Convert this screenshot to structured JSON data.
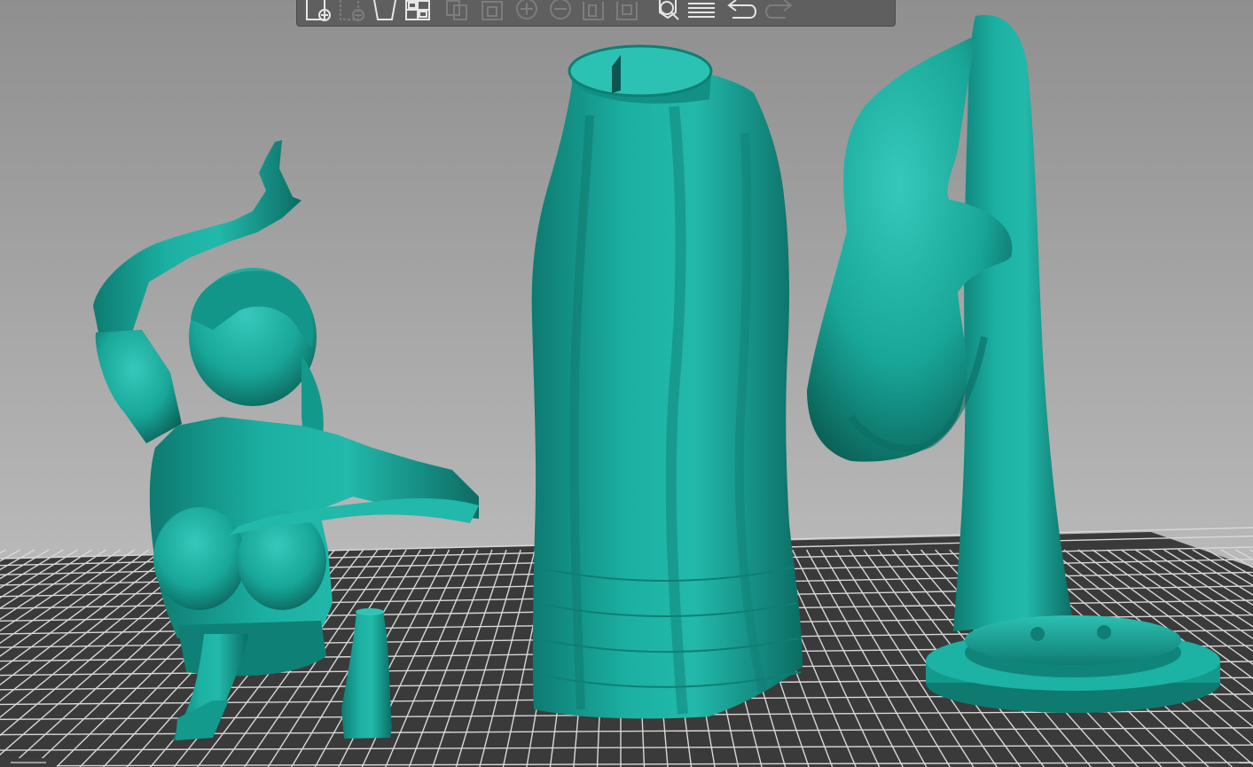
{
  "colors": {
    "model_teal": "#17a89b",
    "model_shadow": "#0d7168",
    "model_highlight": "#3fcfc1",
    "bed_grid": "#dcdcdc",
    "bed_base": "#3a3a3a",
    "toolbar_bg": "#5f5f5f",
    "icon_active": "#e6e6e6",
    "icon_disabled": "#7d7d7d"
  },
  "toolbar": {
    "buttons": [
      {
        "icon": "add-file-icon",
        "enabled": true
      },
      {
        "icon": "remove-selection-icon",
        "enabled": false
      },
      {
        "icon": "delete-all-icon",
        "enabled": true
      },
      {
        "icon": "arrange-icon",
        "enabled": true
      },
      {
        "icon": "copy-icon",
        "enabled": false
      },
      {
        "icon": "paste-icon",
        "enabled": false
      },
      {
        "icon": "add-instance-icon",
        "enabled": false
      },
      {
        "icon": "remove-instance-icon",
        "enabled": false
      },
      {
        "icon": "split-to-objects-icon",
        "enabled": false
      },
      {
        "icon": "split-to-parts-icon",
        "enabled": false
      },
      {
        "icon": "search-icon",
        "enabled": true
      },
      {
        "icon": "layers-editing-icon",
        "enabled": true
      },
      {
        "icon": "undo-icon",
        "enabled": true
      },
      {
        "icon": "redo-icon",
        "enabled": false
      }
    ]
  },
  "scene": {
    "objects": [
      {
        "name": "dancer-torso-model"
      },
      {
        "name": "dancer-foot-left-model"
      },
      {
        "name": "dancer-foot-right-model"
      },
      {
        "name": "skirt-model"
      },
      {
        "name": "dupatta-drape-model"
      },
      {
        "name": "round-base-model"
      }
    ]
  }
}
